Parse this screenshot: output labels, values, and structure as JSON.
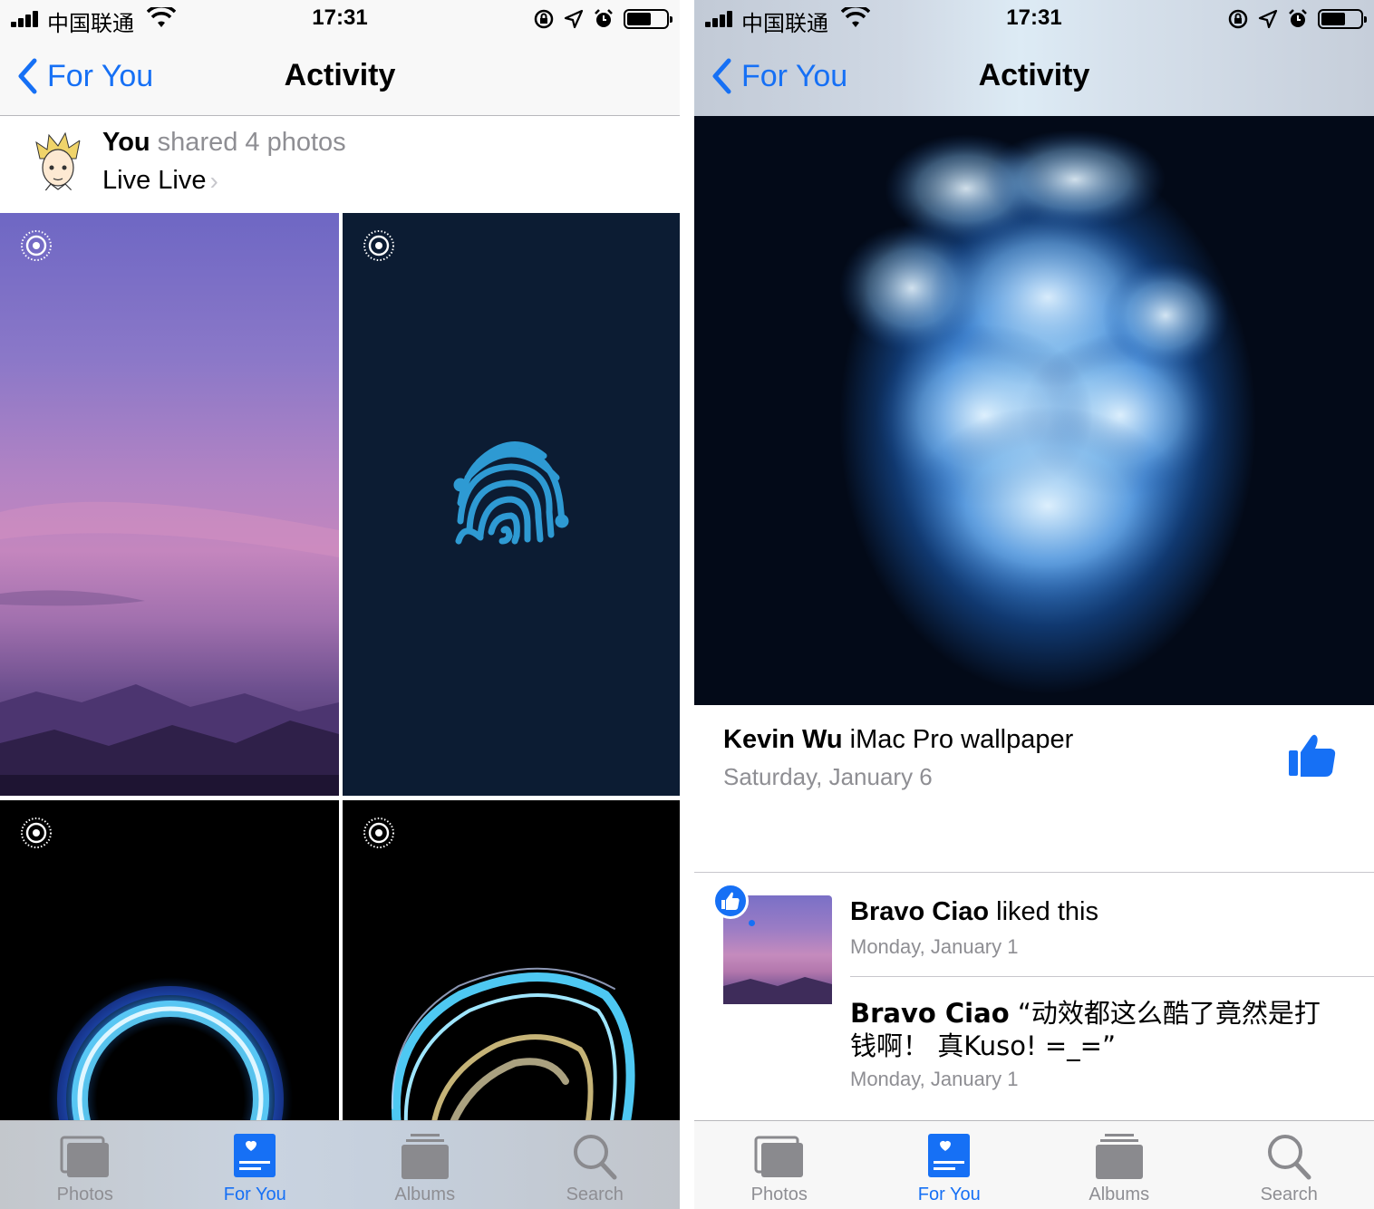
{
  "status_bar": {
    "carrier": "中国联通",
    "time": "17:31"
  },
  "left_screen": {
    "nav": {
      "back_label": "For You",
      "title": "Activity"
    },
    "shared": {
      "who": "You",
      "what": " shared 4 photos",
      "album": "Live Live"
    },
    "tiles": [
      {
        "name": "sunset-photo",
        "live": true
      },
      {
        "name": "fingerprint-photo",
        "live": true
      },
      {
        "name": "blue-ring-photo",
        "live": true
      },
      {
        "name": "neon-wave-photo",
        "live": true
      }
    ]
  },
  "right_screen": {
    "nav": {
      "back_label": "For You",
      "title": "Activity"
    },
    "post": {
      "author": "Kevin Wu",
      "caption": " iMac Pro wallpaper",
      "date": "Saturday, January 6"
    },
    "activity": [
      {
        "who": "Bravo Ciao",
        "text": " liked this",
        "date": "Monday, January 1"
      },
      {
        "who": "Bravo Ciao",
        "text": " “动效都这么酷了竟然是打钱啊！ 真Kuso! =_=”",
        "date": "Monday, January 1"
      }
    ]
  },
  "tabbar": {
    "tabs": [
      {
        "label": "Photos",
        "icon": "photos-icon",
        "active": false
      },
      {
        "label": "For You",
        "icon": "for-you-icon",
        "active": true
      },
      {
        "label": "Albums",
        "icon": "albums-icon",
        "active": false
      },
      {
        "label": "Search",
        "icon": "search-icon",
        "active": false
      }
    ]
  },
  "colors": {
    "accent": "#1670f5",
    "secondary_text": "#8e8e93",
    "separator": "#c8c7cc"
  }
}
